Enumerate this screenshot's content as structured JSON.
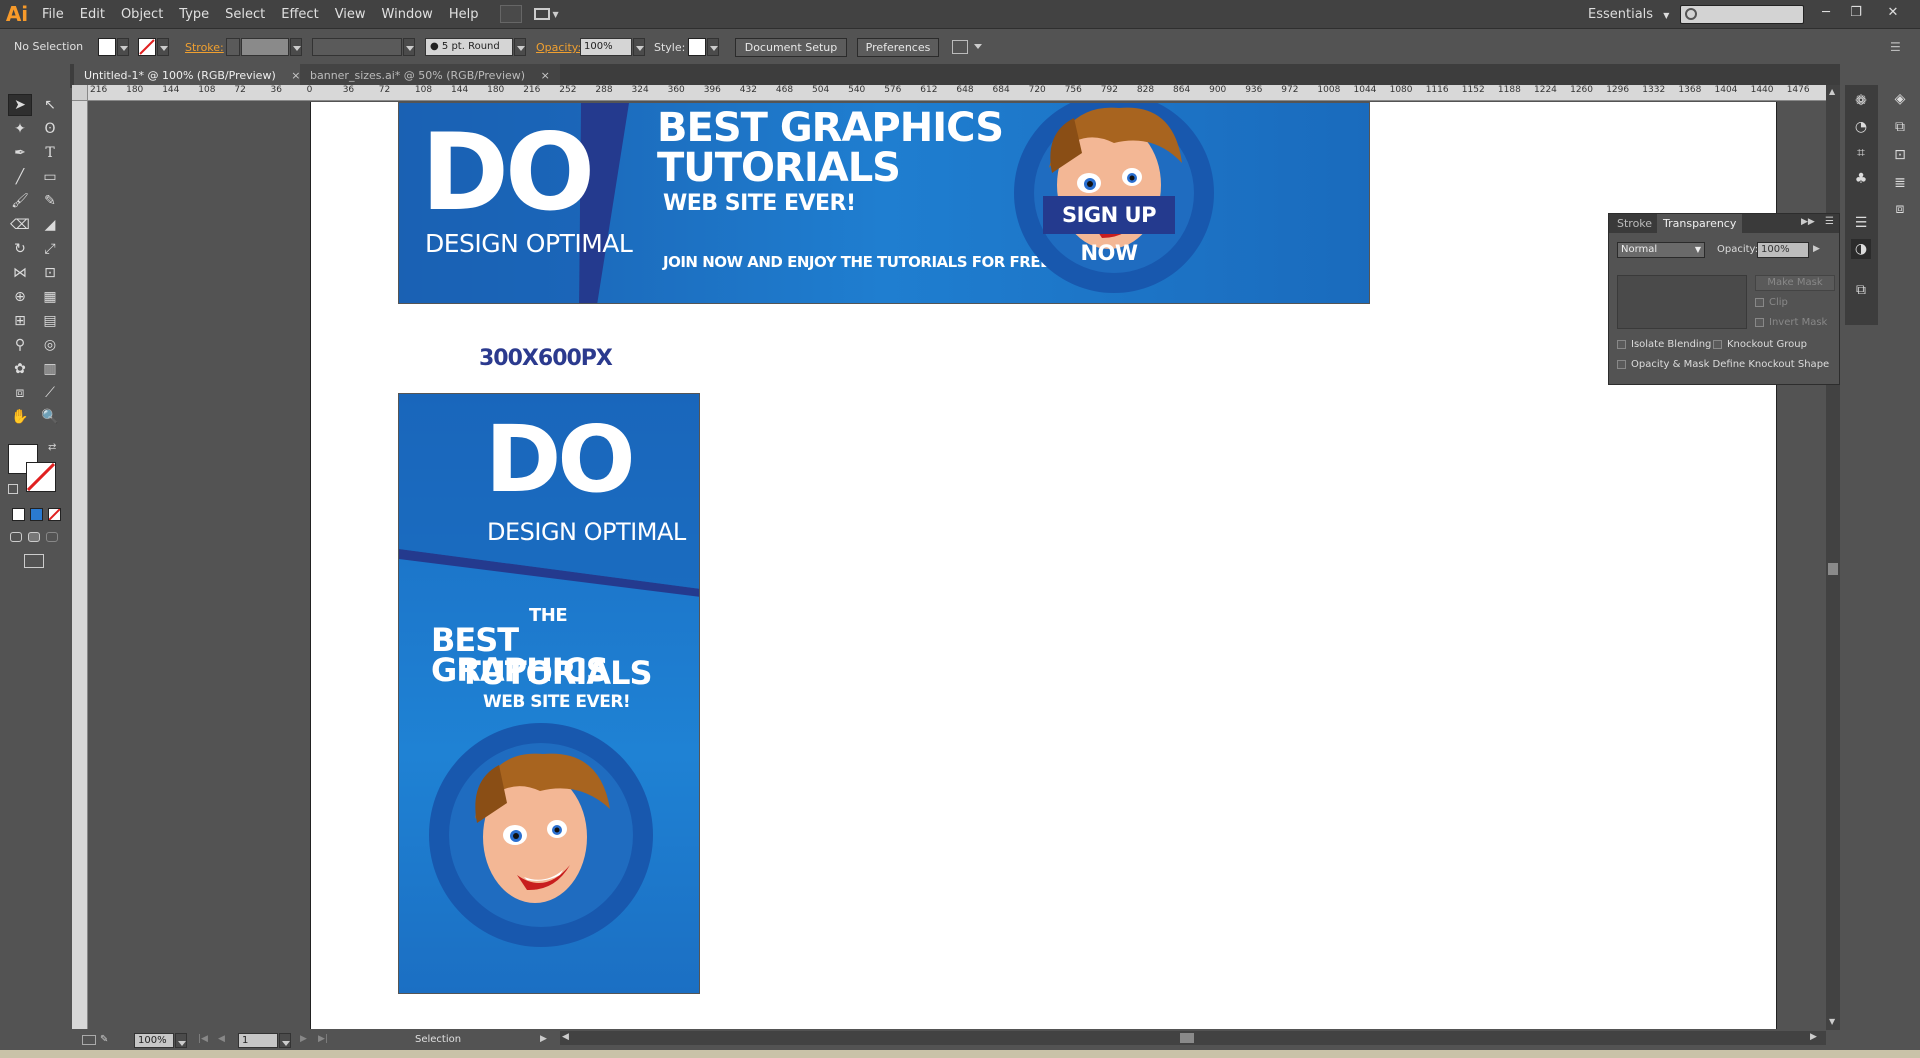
{
  "app": {
    "logo": "Ai",
    "menu": [
      "File",
      "Edit",
      "Object",
      "Type",
      "Select",
      "Effect",
      "View",
      "Window",
      "Help"
    ],
    "workspace": "Essentials",
    "window_controls": [
      "─",
      "❐",
      "✕"
    ]
  },
  "control_bar": {
    "selection": "No Selection",
    "stroke_label": "Stroke:",
    "brush": "5 pt. Round",
    "opacity_label": "Opacity:",
    "opacity_value": "100%",
    "style_label": "Style:",
    "document_setup": "Document Setup",
    "preferences": "Preferences"
  },
  "tabs": [
    {
      "label": "Untitled-1* @ 100% (RGB/Preview)",
      "close": "×"
    },
    {
      "label": "banner_sizes.ai* @ 50% (RGB/Preview)",
      "close": "×"
    }
  ],
  "ruler_top": [
    "216",
    "180",
    "144",
    "108",
    "72",
    "36",
    "0",
    "36",
    "72",
    "108",
    "144",
    "180",
    "216",
    "252",
    "288",
    "324",
    "360",
    "396",
    "432",
    "468",
    "504",
    "540",
    "576",
    "612",
    "648",
    "684",
    "720",
    "756",
    "792",
    "828",
    "864",
    "900",
    "936",
    "972",
    "1008",
    "1044",
    "1080",
    "1116",
    "1152",
    "1188",
    "1224",
    "1260",
    "1296",
    "1332",
    "1368",
    "1404",
    "1440",
    "1476"
  ],
  "artwork": {
    "wide_banner": {
      "logo": "DO",
      "logo_sub": "DESIGN OPTIMAL",
      "headline_1": "BEST GRAPHICS",
      "headline_2": "TUTORIALS",
      "subline": "WEB SITE EVER!",
      "cta_text": "JOIN NOW AND ENJOY THE TUTORIALS FOR FREE",
      "button": "SIGN UP NOW"
    },
    "size_label": "300X600PX",
    "tall_banner": {
      "logo": "DO",
      "logo_sub": "DESIGN OPTIMAL",
      "the": "THE",
      "headline_1": "BEST GRAPHICS",
      "headline_2": "TUTORIALS",
      "subline": "WEB SITE EVER!"
    }
  },
  "transparency_panel": {
    "tab_stroke": "Stroke",
    "tab_transparency": "Transparency",
    "blend_mode": "Normal",
    "opacity_label": "Opacity:",
    "opacity_value": "100%",
    "make_mask": "Make Mask",
    "clip": "Clip",
    "invert_mask": "Invert Mask",
    "isolate_blending": "Isolate Blending",
    "knockout_group": "Knockout Group",
    "opacity_mask_knockout": "Opacity & Mask Define Knockout Shape"
  },
  "status_bar": {
    "zoom": "100%",
    "page": "1",
    "tool": "Selection"
  },
  "colors": {
    "banner_blue": "#1f7ed0",
    "accent_navy": "#243a8e",
    "ai_orange": "#f79a2a"
  }
}
